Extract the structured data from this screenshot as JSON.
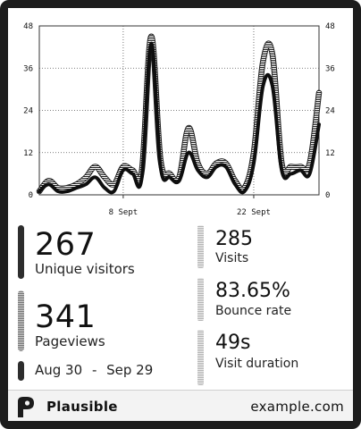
{
  "chart_data": {
    "type": "line",
    "x": [
      1,
      2,
      3,
      4,
      5,
      6,
      7,
      8,
      9,
      10,
      11,
      12,
      13,
      14,
      15,
      16,
      17,
      18,
      19,
      20,
      21,
      22,
      23,
      24,
      25,
      26,
      27,
      28,
      29,
      30,
      31
    ],
    "x_ticks": [
      {
        "x": 10,
        "label": "8 Sept"
      },
      {
        "x": 24,
        "label": "22 Sept"
      }
    ],
    "y_ticks": [
      0,
      12,
      24,
      36,
      48
    ],
    "ylim": [
      0,
      48
    ],
    "grid": true,
    "series": [
      {
        "style": "bold-solid",
        "values": [
          1,
          3,
          1,
          1,
          2,
          3,
          5,
          2,
          1,
          7,
          6,
          5,
          43,
          8,
          5,
          4,
          12,
          7,
          5,
          8,
          8,
          3,
          1,
          9,
          31,
          31,
          7,
          6,
          7,
          6,
          20
        ]
      },
      {
        "style": "hatched",
        "values": [
          1,
          4,
          2,
          2,
          3,
          5,
          8,
          5,
          3,
          8,
          7,
          7,
          45,
          10,
          6,
          5,
          19,
          9,
          6,
          9,
          9,
          4,
          2,
          12,
          38,
          40,
          9,
          8,
          8,
          9,
          29
        ]
      }
    ]
  },
  "stats": {
    "unique_visitors": {
      "value": "267",
      "label": "Unique visitors"
    },
    "pageviews": {
      "value": "341",
      "label": "Pageviews"
    },
    "visits": {
      "value": "285",
      "label": "Visits"
    },
    "bounce_rate": {
      "value": "83.65%",
      "label": "Bounce rate"
    },
    "visit_duration": {
      "value": "49s",
      "label": "Visit duration"
    }
  },
  "date_range": {
    "start": "Aug 30",
    "separator": "-",
    "end": "Sep 29"
  },
  "footer": {
    "brand": "Plausible",
    "domain": "example.com"
  }
}
